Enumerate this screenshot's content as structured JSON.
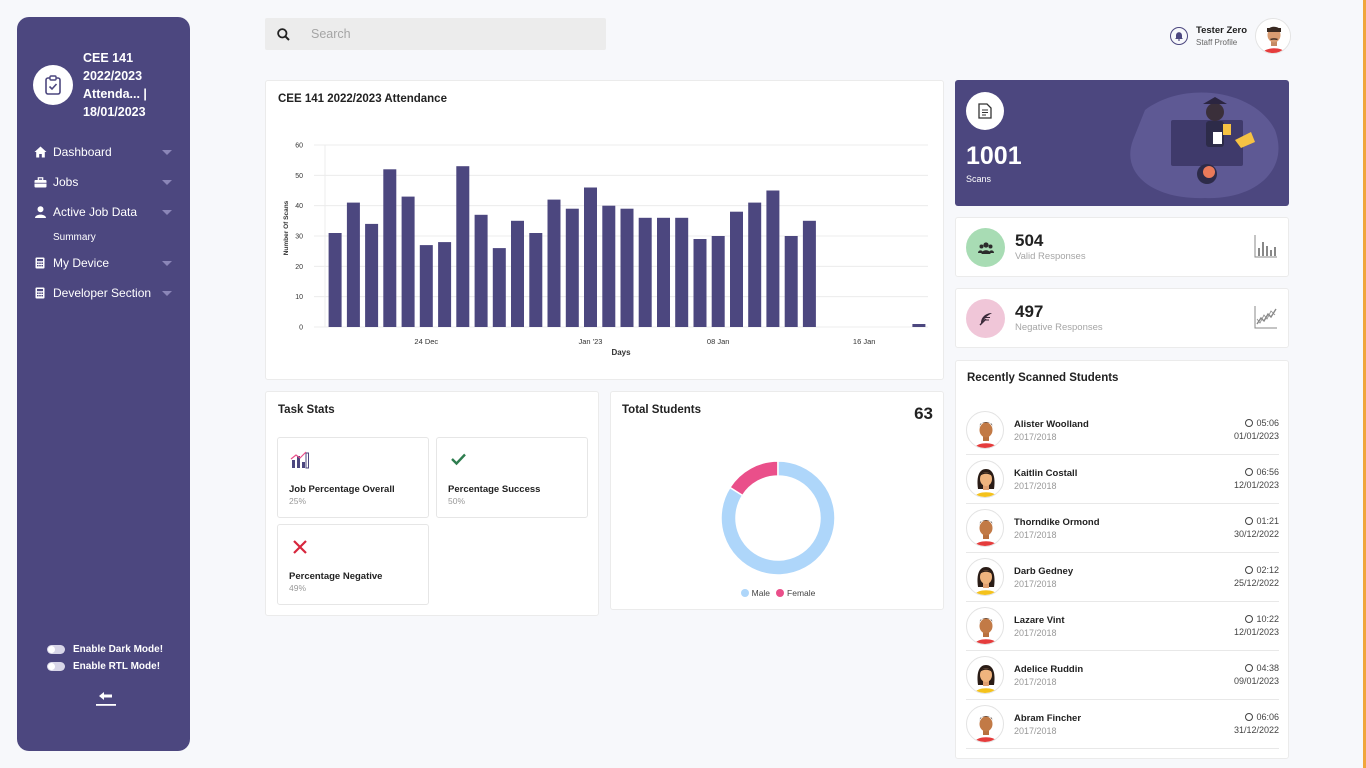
{
  "sidebar": {
    "brand_title": "CEE 141 2022/2023 Attenda... | 18/01/2023",
    "items": [
      {
        "label": "Dashboard",
        "icon": "home-icon"
      },
      {
        "label": "Jobs",
        "icon": "briefcase-icon"
      },
      {
        "label": "Active Job Data",
        "icon": "user-icon"
      },
      {
        "label": "My Device",
        "icon": "calculator-icon"
      },
      {
        "label": "Developer Section",
        "icon": "calculator-icon"
      }
    ],
    "sub_item": "Summary",
    "dark_mode_label": "Enable Dark Mode!",
    "rtl_mode_label": "Enable RTL Mode!"
  },
  "search": {
    "placeholder": "Search"
  },
  "profile": {
    "name": "Tester Zero",
    "role": "Staff Profile"
  },
  "attendance": {
    "title": "CEE 141 2022/2023 Attendance"
  },
  "scans": {
    "count": "1001",
    "label": "Scans"
  },
  "valid": {
    "count": "504",
    "label": "Valid Responses"
  },
  "negative": {
    "count": "497",
    "label": "Negative Responses"
  },
  "task_stats": {
    "title": "Task Stats",
    "tiles": [
      {
        "label": "Job Percentage Overall",
        "value": "25%",
        "icon": "bar-chart-icon"
      },
      {
        "label": "Percentage Success",
        "value": "50%",
        "icon": "check-icon"
      },
      {
        "label": "Percentage Negative",
        "value": "49%",
        "icon": "cross-icon"
      }
    ]
  },
  "students": {
    "title": "Total Students",
    "total": "63",
    "legend": [
      "Male",
      "Female"
    ],
    "male_fraction": 0.84,
    "female_fraction": 0.16,
    "colors": {
      "male": "#aed6fa",
      "female": "#ea4f8a"
    }
  },
  "recent": {
    "title": "Recently Scanned Students",
    "rows": [
      {
        "name": "Alister Woolland",
        "year": "2017/2018",
        "time": "05:06",
        "date": "01/01/2023",
        "gender": "male"
      },
      {
        "name": "Kaitlin Costall",
        "year": "2017/2018",
        "time": "06:56",
        "date": "12/01/2023",
        "gender": "female"
      },
      {
        "name": "Thorndike Ormond",
        "year": "2017/2018",
        "time": "01:21",
        "date": "30/12/2022",
        "gender": "male"
      },
      {
        "name": "Darb Gedney",
        "year": "2017/2018",
        "time": "02:12",
        "date": "25/12/2022",
        "gender": "female"
      },
      {
        "name": "Lazare Vint",
        "year": "2017/2018",
        "time": "10:22",
        "date": "12/01/2023",
        "gender": "male"
      },
      {
        "name": "Adelice Ruddin",
        "year": "2017/2018",
        "time": "04:38",
        "date": "09/01/2023",
        "gender": "female"
      },
      {
        "name": "Abram Fincher",
        "year": "2017/2018",
        "time": "06:06",
        "date": "31/12/2022",
        "gender": "male"
      }
    ]
  },
  "colors": {
    "primary": "#4c477f",
    "bar": "#4c477f",
    "accent_edge": "#f0a63c",
    "valid_circle": "#a8dcb4",
    "negative_circle": "#f0c6d8"
  },
  "chart_data": {
    "type": "bar",
    "title": "",
    "xlabel": "Days",
    "ylabel": "Number Of Scans",
    "ylim": [
      0,
      60
    ],
    "yticks": [
      0,
      10,
      20,
      30,
      40,
      50,
      60
    ],
    "xticks": [
      "24 Dec",
      "Jan '23",
      "08 Jan",
      "16 Jan"
    ],
    "values": [
      31,
      41,
      34,
      52,
      43,
      27,
      28,
      53,
      37,
      26,
      35,
      31,
      42,
      39,
      46,
      40,
      39,
      36,
      36,
      36,
      29,
      30,
      38,
      41,
      45,
      30,
      35,
      0,
      0,
      0,
      0,
      0,
      1
    ],
    "grid": true
  }
}
